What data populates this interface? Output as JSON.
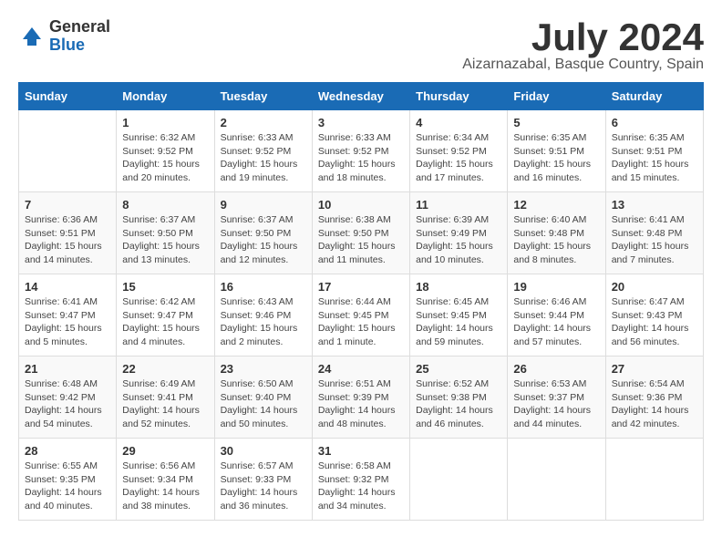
{
  "logo": {
    "general": "General",
    "blue": "Blue"
  },
  "title": "July 2024",
  "location": "Aizarnazabal, Basque Country, Spain",
  "days_header": [
    "Sunday",
    "Monday",
    "Tuesday",
    "Wednesday",
    "Thursday",
    "Friday",
    "Saturday"
  ],
  "weeks": [
    [
      {
        "num": "",
        "info": ""
      },
      {
        "num": "1",
        "info": "Sunrise: 6:32 AM\nSunset: 9:52 PM\nDaylight: 15 hours\nand 20 minutes."
      },
      {
        "num": "2",
        "info": "Sunrise: 6:33 AM\nSunset: 9:52 PM\nDaylight: 15 hours\nand 19 minutes."
      },
      {
        "num": "3",
        "info": "Sunrise: 6:33 AM\nSunset: 9:52 PM\nDaylight: 15 hours\nand 18 minutes."
      },
      {
        "num": "4",
        "info": "Sunrise: 6:34 AM\nSunset: 9:52 PM\nDaylight: 15 hours\nand 17 minutes."
      },
      {
        "num": "5",
        "info": "Sunrise: 6:35 AM\nSunset: 9:51 PM\nDaylight: 15 hours\nand 16 minutes."
      },
      {
        "num": "6",
        "info": "Sunrise: 6:35 AM\nSunset: 9:51 PM\nDaylight: 15 hours\nand 15 minutes."
      }
    ],
    [
      {
        "num": "7",
        "info": "Sunrise: 6:36 AM\nSunset: 9:51 PM\nDaylight: 15 hours\nand 14 minutes."
      },
      {
        "num": "8",
        "info": "Sunrise: 6:37 AM\nSunset: 9:50 PM\nDaylight: 15 hours\nand 13 minutes."
      },
      {
        "num": "9",
        "info": "Sunrise: 6:37 AM\nSunset: 9:50 PM\nDaylight: 15 hours\nand 12 minutes."
      },
      {
        "num": "10",
        "info": "Sunrise: 6:38 AM\nSunset: 9:50 PM\nDaylight: 15 hours\nand 11 minutes."
      },
      {
        "num": "11",
        "info": "Sunrise: 6:39 AM\nSunset: 9:49 PM\nDaylight: 15 hours\nand 10 minutes."
      },
      {
        "num": "12",
        "info": "Sunrise: 6:40 AM\nSunset: 9:48 PM\nDaylight: 15 hours\nand 8 minutes."
      },
      {
        "num": "13",
        "info": "Sunrise: 6:41 AM\nSunset: 9:48 PM\nDaylight: 15 hours\nand 7 minutes."
      }
    ],
    [
      {
        "num": "14",
        "info": "Sunrise: 6:41 AM\nSunset: 9:47 PM\nDaylight: 15 hours\nand 5 minutes."
      },
      {
        "num": "15",
        "info": "Sunrise: 6:42 AM\nSunset: 9:47 PM\nDaylight: 15 hours\nand 4 minutes."
      },
      {
        "num": "16",
        "info": "Sunrise: 6:43 AM\nSunset: 9:46 PM\nDaylight: 15 hours\nand 2 minutes."
      },
      {
        "num": "17",
        "info": "Sunrise: 6:44 AM\nSunset: 9:45 PM\nDaylight: 15 hours\nand 1 minute."
      },
      {
        "num": "18",
        "info": "Sunrise: 6:45 AM\nSunset: 9:45 PM\nDaylight: 14 hours\nand 59 minutes."
      },
      {
        "num": "19",
        "info": "Sunrise: 6:46 AM\nSunset: 9:44 PM\nDaylight: 14 hours\nand 57 minutes."
      },
      {
        "num": "20",
        "info": "Sunrise: 6:47 AM\nSunset: 9:43 PM\nDaylight: 14 hours\nand 56 minutes."
      }
    ],
    [
      {
        "num": "21",
        "info": "Sunrise: 6:48 AM\nSunset: 9:42 PM\nDaylight: 14 hours\nand 54 minutes."
      },
      {
        "num": "22",
        "info": "Sunrise: 6:49 AM\nSunset: 9:41 PM\nDaylight: 14 hours\nand 52 minutes."
      },
      {
        "num": "23",
        "info": "Sunrise: 6:50 AM\nSunset: 9:40 PM\nDaylight: 14 hours\nand 50 minutes."
      },
      {
        "num": "24",
        "info": "Sunrise: 6:51 AM\nSunset: 9:39 PM\nDaylight: 14 hours\nand 48 minutes."
      },
      {
        "num": "25",
        "info": "Sunrise: 6:52 AM\nSunset: 9:38 PM\nDaylight: 14 hours\nand 46 minutes."
      },
      {
        "num": "26",
        "info": "Sunrise: 6:53 AM\nSunset: 9:37 PM\nDaylight: 14 hours\nand 44 minutes."
      },
      {
        "num": "27",
        "info": "Sunrise: 6:54 AM\nSunset: 9:36 PM\nDaylight: 14 hours\nand 42 minutes."
      }
    ],
    [
      {
        "num": "28",
        "info": "Sunrise: 6:55 AM\nSunset: 9:35 PM\nDaylight: 14 hours\nand 40 minutes."
      },
      {
        "num": "29",
        "info": "Sunrise: 6:56 AM\nSunset: 9:34 PM\nDaylight: 14 hours\nand 38 minutes."
      },
      {
        "num": "30",
        "info": "Sunrise: 6:57 AM\nSunset: 9:33 PM\nDaylight: 14 hours\nand 36 minutes."
      },
      {
        "num": "31",
        "info": "Sunrise: 6:58 AM\nSunset: 9:32 PM\nDaylight: 14 hours\nand 34 minutes."
      },
      {
        "num": "",
        "info": ""
      },
      {
        "num": "",
        "info": ""
      },
      {
        "num": "",
        "info": ""
      }
    ]
  ]
}
